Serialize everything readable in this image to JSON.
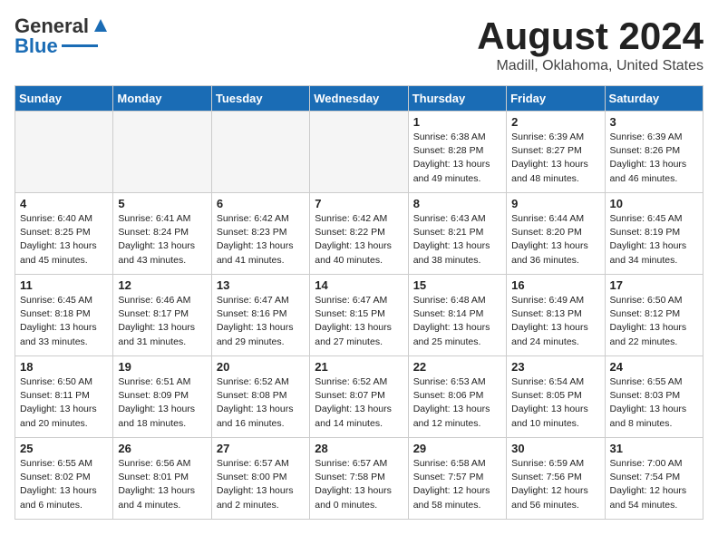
{
  "header": {
    "logo_general": "General",
    "logo_blue": "Blue",
    "title": "August 2024",
    "subtitle": "Madill, Oklahoma, United States"
  },
  "weekdays": [
    "Sunday",
    "Monday",
    "Tuesday",
    "Wednesday",
    "Thursday",
    "Friday",
    "Saturday"
  ],
  "weeks": [
    [
      {
        "day": "",
        "info": ""
      },
      {
        "day": "",
        "info": ""
      },
      {
        "day": "",
        "info": ""
      },
      {
        "day": "",
        "info": ""
      },
      {
        "day": "1",
        "info": "Sunrise: 6:38 AM\nSunset: 8:28 PM\nDaylight: 13 hours and 49 minutes."
      },
      {
        "day": "2",
        "info": "Sunrise: 6:39 AM\nSunset: 8:27 PM\nDaylight: 13 hours and 48 minutes."
      },
      {
        "day": "3",
        "info": "Sunrise: 6:39 AM\nSunset: 8:26 PM\nDaylight: 13 hours and 46 minutes."
      }
    ],
    [
      {
        "day": "4",
        "info": "Sunrise: 6:40 AM\nSunset: 8:25 PM\nDaylight: 13 hours and 45 minutes."
      },
      {
        "day": "5",
        "info": "Sunrise: 6:41 AM\nSunset: 8:24 PM\nDaylight: 13 hours and 43 minutes."
      },
      {
        "day": "6",
        "info": "Sunrise: 6:42 AM\nSunset: 8:23 PM\nDaylight: 13 hours and 41 minutes."
      },
      {
        "day": "7",
        "info": "Sunrise: 6:42 AM\nSunset: 8:22 PM\nDaylight: 13 hours and 40 minutes."
      },
      {
        "day": "8",
        "info": "Sunrise: 6:43 AM\nSunset: 8:21 PM\nDaylight: 13 hours and 38 minutes."
      },
      {
        "day": "9",
        "info": "Sunrise: 6:44 AM\nSunset: 8:20 PM\nDaylight: 13 hours and 36 minutes."
      },
      {
        "day": "10",
        "info": "Sunrise: 6:45 AM\nSunset: 8:19 PM\nDaylight: 13 hours and 34 minutes."
      }
    ],
    [
      {
        "day": "11",
        "info": "Sunrise: 6:45 AM\nSunset: 8:18 PM\nDaylight: 13 hours and 33 minutes."
      },
      {
        "day": "12",
        "info": "Sunrise: 6:46 AM\nSunset: 8:17 PM\nDaylight: 13 hours and 31 minutes."
      },
      {
        "day": "13",
        "info": "Sunrise: 6:47 AM\nSunset: 8:16 PM\nDaylight: 13 hours and 29 minutes."
      },
      {
        "day": "14",
        "info": "Sunrise: 6:47 AM\nSunset: 8:15 PM\nDaylight: 13 hours and 27 minutes."
      },
      {
        "day": "15",
        "info": "Sunrise: 6:48 AM\nSunset: 8:14 PM\nDaylight: 13 hours and 25 minutes."
      },
      {
        "day": "16",
        "info": "Sunrise: 6:49 AM\nSunset: 8:13 PM\nDaylight: 13 hours and 24 minutes."
      },
      {
        "day": "17",
        "info": "Sunrise: 6:50 AM\nSunset: 8:12 PM\nDaylight: 13 hours and 22 minutes."
      }
    ],
    [
      {
        "day": "18",
        "info": "Sunrise: 6:50 AM\nSunset: 8:11 PM\nDaylight: 13 hours and 20 minutes."
      },
      {
        "day": "19",
        "info": "Sunrise: 6:51 AM\nSunset: 8:09 PM\nDaylight: 13 hours and 18 minutes."
      },
      {
        "day": "20",
        "info": "Sunrise: 6:52 AM\nSunset: 8:08 PM\nDaylight: 13 hours and 16 minutes."
      },
      {
        "day": "21",
        "info": "Sunrise: 6:52 AM\nSunset: 8:07 PM\nDaylight: 13 hours and 14 minutes."
      },
      {
        "day": "22",
        "info": "Sunrise: 6:53 AM\nSunset: 8:06 PM\nDaylight: 13 hours and 12 minutes."
      },
      {
        "day": "23",
        "info": "Sunrise: 6:54 AM\nSunset: 8:05 PM\nDaylight: 13 hours and 10 minutes."
      },
      {
        "day": "24",
        "info": "Sunrise: 6:55 AM\nSunset: 8:03 PM\nDaylight: 13 hours and 8 minutes."
      }
    ],
    [
      {
        "day": "25",
        "info": "Sunrise: 6:55 AM\nSunset: 8:02 PM\nDaylight: 13 hours and 6 minutes."
      },
      {
        "day": "26",
        "info": "Sunrise: 6:56 AM\nSunset: 8:01 PM\nDaylight: 13 hours and 4 minutes."
      },
      {
        "day": "27",
        "info": "Sunrise: 6:57 AM\nSunset: 8:00 PM\nDaylight: 13 hours and 2 minutes."
      },
      {
        "day": "28",
        "info": "Sunrise: 6:57 AM\nSunset: 7:58 PM\nDaylight: 13 hours and 0 minutes."
      },
      {
        "day": "29",
        "info": "Sunrise: 6:58 AM\nSunset: 7:57 PM\nDaylight: 12 hours and 58 minutes."
      },
      {
        "day": "30",
        "info": "Sunrise: 6:59 AM\nSunset: 7:56 PM\nDaylight: 12 hours and 56 minutes."
      },
      {
        "day": "31",
        "info": "Sunrise: 7:00 AM\nSunset: 7:54 PM\nDaylight: 12 hours and 54 minutes."
      }
    ]
  ]
}
